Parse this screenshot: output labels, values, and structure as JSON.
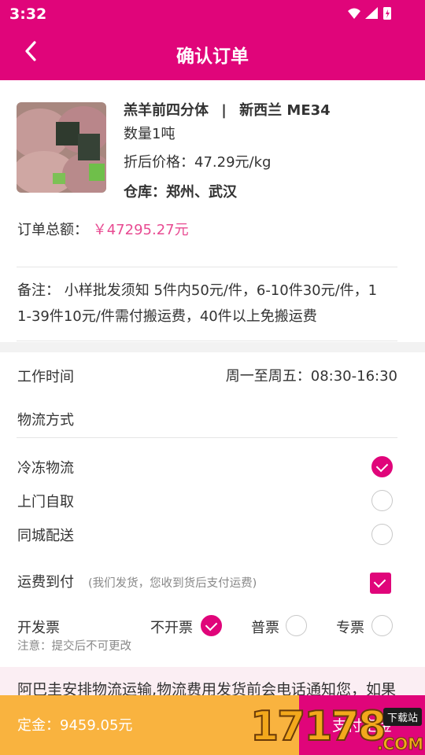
{
  "status": {
    "time": "3:32"
  },
  "header": {
    "title": "确认订单"
  },
  "product": {
    "name": "羔羊前四分体",
    "separator": "|",
    "origin": "新西兰 ME34",
    "quantity": "数量1吨",
    "price": "折后价格：47.29元/kg",
    "warehouse": "仓库：郑州、武汉"
  },
  "order": {
    "total_label": "订单总额：",
    "total_value": "￥47295.27元"
  },
  "remark": {
    "line1": "备注： 小样批发须知 5件内50元/件，6-10件30元/件，1",
    "line2": "1-39件10元/件需付搬运费，40件以上免搬运费"
  },
  "work_time": {
    "label": "工作时间",
    "value": "周一至周五：08:30-16:30"
  },
  "logistics": {
    "label": "物流方式",
    "options": [
      {
        "label": "冷冻物流",
        "selected": true
      },
      {
        "label": "上门自取",
        "selected": false
      },
      {
        "label": "同城配送",
        "selected": false
      }
    ]
  },
  "freight": {
    "label": "运费到付",
    "hint": "(我们发货，您收到货后支付运费)",
    "checked": true
  },
  "invoice": {
    "label": "开发票",
    "options": [
      {
        "label": "不开票",
        "selected": true
      },
      {
        "label": "普票",
        "selected": false
      },
      {
        "label": "专票",
        "selected": false
      }
    ],
    "note": "注意：提交后不可更改"
  },
  "notice": {
    "text": "阿巴圭安排物流运输,物流费用发货前会电话通知您，如果"
  },
  "footer": {
    "deposit": "定金：9459.05元",
    "pay": "支付定金"
  },
  "watermark": {
    "number": "17178",
    "tag": "下载站",
    "com": ".COM"
  },
  "colors": {
    "accent": "#e0057a",
    "price": "#e84b92",
    "deposit_bg": "#f9b33f"
  }
}
